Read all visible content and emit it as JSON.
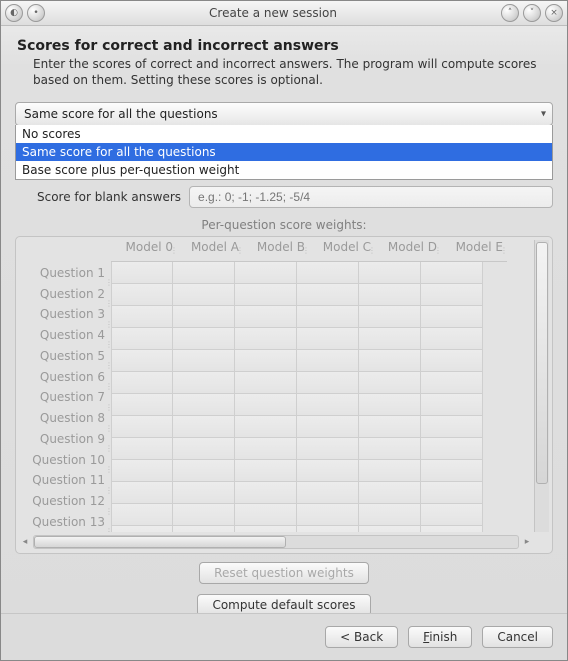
{
  "window": {
    "title": "Create a new session"
  },
  "header": {
    "title": "Scores for correct and incorrect answers",
    "subtitle": "Enter the scores of correct and incorrect answers. The program will compute scores based on them. Setting these scores is optional."
  },
  "score_mode": {
    "selected": "Same score for all the questions",
    "options": [
      "No scores",
      "Same score for all the questions",
      "Base score plus per-question weight"
    ],
    "selected_index": 1
  },
  "blank": {
    "label": "Score for blank answers",
    "placeholder": "e.g.: 0; -1; -1.25; -5/4",
    "value": ""
  },
  "weights": {
    "title": "Per-question score weights:",
    "columns": [
      "Model 0",
      "Model A",
      "Model B",
      "Model C",
      "Model D",
      "Model E"
    ],
    "rows": [
      "Question 1",
      "Question 2",
      "Question 3",
      "Question 4",
      "Question 5",
      "Question 6",
      "Question 7",
      "Question 8",
      "Question 9",
      "Question 10",
      "Question 11",
      "Question 12",
      "Question 13"
    ]
  },
  "buttons": {
    "reset": "Reset question weights",
    "compute": "Compute default scores",
    "back": "< Back",
    "finish": "Finish",
    "cancel": "Cancel"
  },
  "titlebar_icons": {
    "app": "app-icon",
    "min": "minimize-icon",
    "up": "up-icon",
    "down": "down-icon",
    "close": "close-icon"
  }
}
